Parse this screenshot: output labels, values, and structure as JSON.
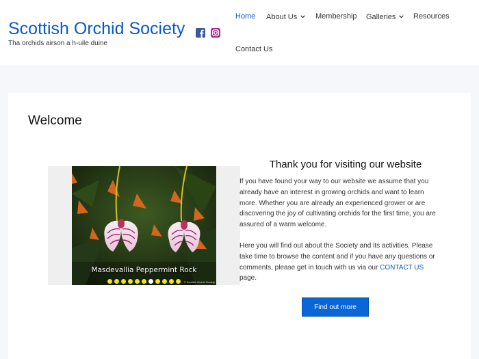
{
  "header": {
    "site_title": "Scottish Orchid Society",
    "tagline": "Tha orchids airson a h-uile duine",
    "social": [
      {
        "icon": "facebook-icon",
        "color": "#3b5998"
      },
      {
        "icon": "instagram-icon",
        "color": "#a5278f"
      }
    ]
  },
  "nav": {
    "items": [
      {
        "label": "Home",
        "active": true,
        "has_dropdown": false
      },
      {
        "label": "About Us",
        "active": false,
        "has_dropdown": true
      },
      {
        "label": "Membership",
        "active": false,
        "has_dropdown": false
      },
      {
        "label": "Galleries",
        "active": false,
        "has_dropdown": true
      },
      {
        "label": "Resources",
        "active": false,
        "has_dropdown": false
      },
      {
        "label": "Contact Us",
        "active": false,
        "has_dropdown": false
      }
    ]
  },
  "main": {
    "title": "Welcome",
    "slider": {
      "caption": "Masdevallia Peppermint Rock",
      "credit": "© Scottish Orchid Society",
      "dot_count": 11,
      "current_index": 6
    },
    "heading": "Thank you for visiting our website",
    "paragraph1": "If you have found your way to our website we assume that you already have an interest in growing orchids and want to learn more. Whether you are already an experienced grower or are discovering the joy of cultivating orchids for the first time, you are assured of a warm welcome.",
    "paragraph2_before": "Here you will find out about the Society and its activities. Please take time to browse the content and if you have any questions or comments, please get in touch with us via our ",
    "paragraph2_link": "CONTACT US",
    "paragraph2_after": " page.",
    "button_label": "Find out more"
  },
  "colors": {
    "brand": "#0a59c8",
    "button": "#0a66d6",
    "dot": "#f2e51a"
  }
}
